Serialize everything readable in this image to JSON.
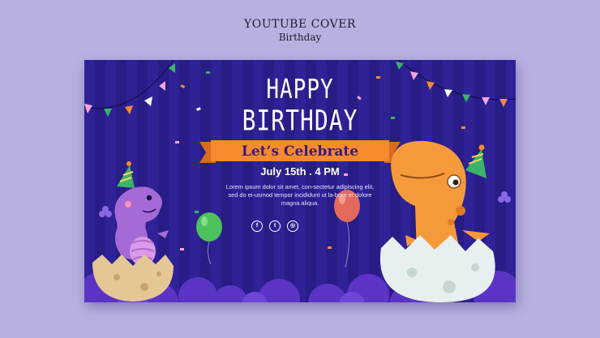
{
  "header": {
    "title": "YOUTUBE COVER",
    "subtitle": "Birthday"
  },
  "cover": {
    "headline_line1": "HAPPY",
    "headline_line2": "BIRTHDAY",
    "ribbon_text": "Let’s Celebrate",
    "date": "July 15th . 4 PM",
    "body_text": "Lorem ipsum dolor sit amet, con-sectetur adipiscing elit, sed do ei-usmod tempor incididunt ut la-bore et dolore magna aliqua.",
    "social_icons": [
      "facebook-icon",
      "twitter-icon",
      "instagram-icon"
    ]
  },
  "colors": {
    "page_bg": "#b9b0e2",
    "banner_bg": "#2b1f8e",
    "ribbon": "#f58a2e",
    "dino_purple": "#a46ad6",
    "dino_orange": "#f59a3b"
  }
}
